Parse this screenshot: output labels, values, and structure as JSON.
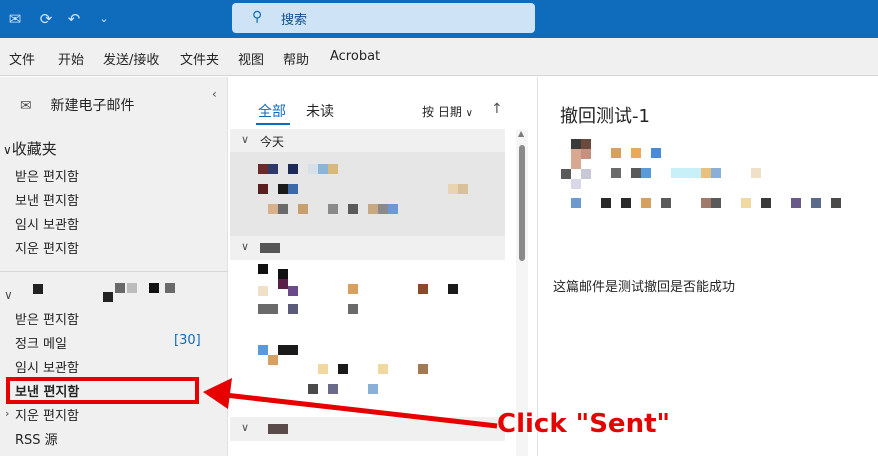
{
  "search": {
    "placeholder": "搜索"
  },
  "menu": [
    "文件",
    "开始",
    "发送/接收",
    "文件夹",
    "视图",
    "帮助",
    "Acrobat"
  ],
  "nav": {
    "new_mail": "新建电子邮件",
    "favorites_label": "收藏夹",
    "favorites": [
      "받은 편지함",
      "보낸 편지함",
      "임시 보관함",
      "지운 편지함"
    ],
    "account_folders": [
      "받은 편지함",
      "정크 메일",
      "임시 보관함",
      "보낸 편지함",
      "지운 편지함",
      "RSS 源"
    ],
    "junk_count": "[30]"
  },
  "list": {
    "tab_all": "全部",
    "tab_unread": "未读",
    "sort_label": "按 日期",
    "sort_caret": "∨",
    "sort_arrow": "↑",
    "group_today": "今天"
  },
  "reading": {
    "subject": "撤回测试-1",
    "body": "这篇邮件是测试撤回是否能成功"
  },
  "annotation": {
    "text": "Click \"Sent\"",
    "color": "#e60000"
  },
  "colors": {
    "accent": "#0f6cbd",
    "titlebar": "#0f6cbd",
    "annotation": "#e60000"
  }
}
